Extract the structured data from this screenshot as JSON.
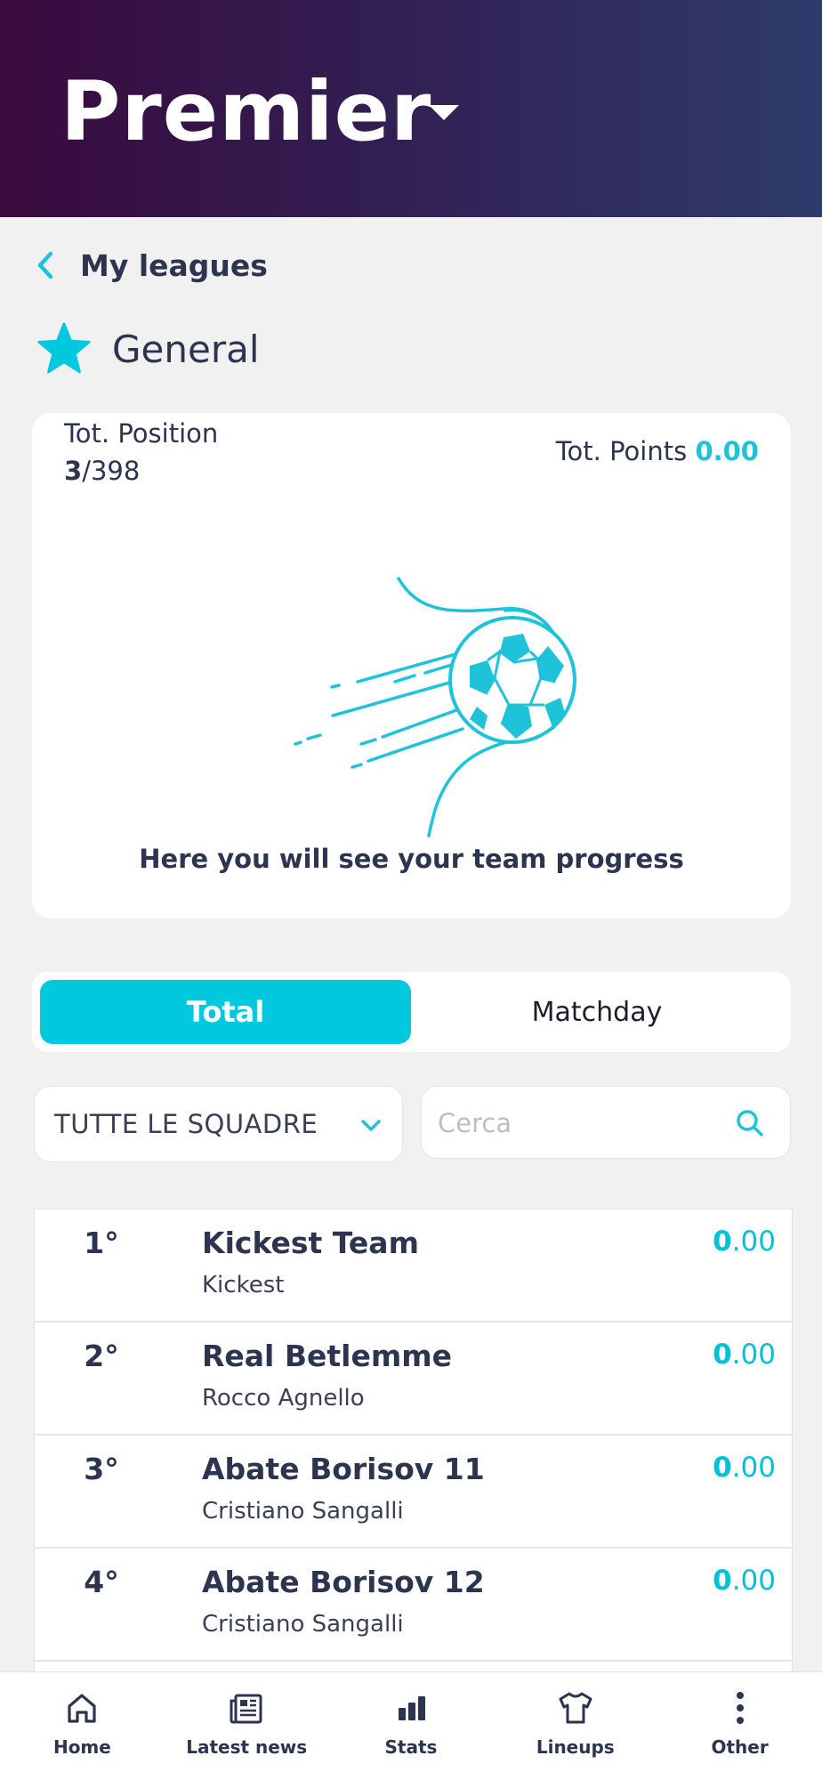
{
  "header": {
    "title": "Premier",
    "caret_icon": "caret-down-icon"
  },
  "breadcrumb": {
    "back_label": "My leagues",
    "icon": "chevron-left-icon"
  },
  "section": {
    "title": "General",
    "icon": "star-icon"
  },
  "summary": {
    "position_label": "Tot. Position",
    "position_rank": "3",
    "position_total": "/398",
    "points_label": "Tot. Points",
    "points_value": "0.00",
    "empty_message": "Here you will see your team progress"
  },
  "tabs": {
    "total": "Total",
    "matchday": "Matchday",
    "active": "total"
  },
  "filters": {
    "team_select": "TUTTE LE SQUADRE",
    "search_placeholder": "Cerca"
  },
  "standings": [
    {
      "rank": "1°",
      "team": "Kickest Team",
      "owner": "Kickest",
      "score_int": "0",
      "score_dec": ".00"
    },
    {
      "rank": "2°",
      "team": "Real Betlemme",
      "owner": "Rocco Agnello",
      "score_int": "0",
      "score_dec": ".00"
    },
    {
      "rank": "3°",
      "team": "Abate Borisov 11",
      "owner": "Cristiano Sangalli",
      "score_int": "0",
      "score_dec": ".00"
    },
    {
      "rank": "4°",
      "team": "Abate Borisov 12",
      "owner": "Cristiano Sangalli",
      "score_int": "0",
      "score_dec": ".00"
    }
  ],
  "nav": [
    {
      "label": "Home",
      "icon": "home-icon"
    },
    {
      "label": "Latest news",
      "icon": "news-icon"
    },
    {
      "label": "Stats",
      "icon": "stats-icon"
    },
    {
      "label": "Lineups",
      "icon": "shirt-icon"
    },
    {
      "label": "Other",
      "icon": "more-icon"
    }
  ],
  "colors": {
    "accent": "#00c8df",
    "text": "#2c3450",
    "header_start": "#3a0a3e",
    "header_end": "#2f3b6c"
  }
}
